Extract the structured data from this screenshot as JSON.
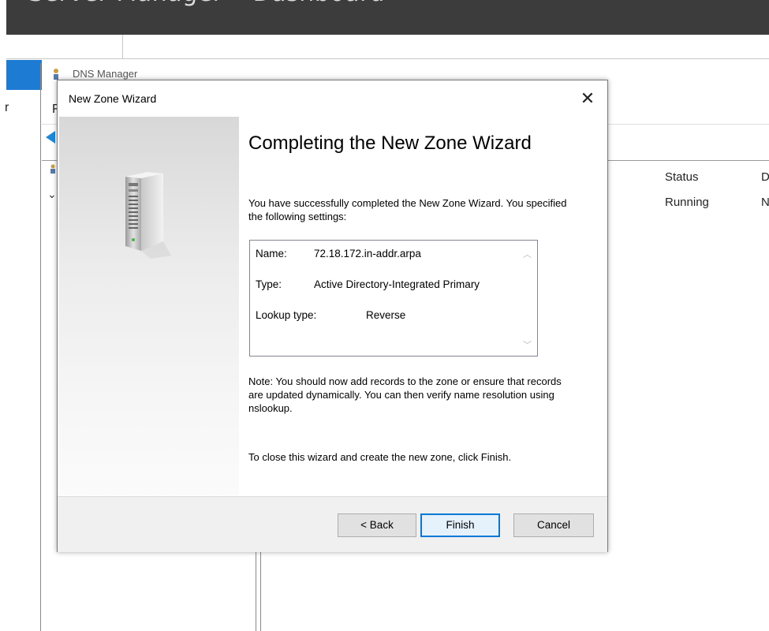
{
  "server_manager": {
    "title": "Server Manager • Dashboard",
    "left_edge_text": "r"
  },
  "dns_manager": {
    "title": "DNS Manager",
    "menu_letter": "F",
    "columns": {
      "status": "Status",
      "d": "D"
    },
    "row": {
      "status": "Running",
      "d": "N"
    }
  },
  "wizard": {
    "title": "New Zone Wizard",
    "close_glyph": "✕",
    "heading": "Completing the New Zone Wizard",
    "intro": "You have successfully completed the New Zone Wizard. You specified the following settings:",
    "settings": {
      "name_label": "Name:",
      "name_value": "72.18.172.in-addr.arpa",
      "type_label": "Type:",
      "type_value": "Active Directory-Integrated Primary",
      "lookup_label": "Lookup type:",
      "lookup_value": "Reverse"
    },
    "note": "Note: You should now add records to the zone or ensure that records are updated dynamically. You can then verify name resolution using nslookup.",
    "closing": "To close this wizard and create the new zone, click Finish.",
    "buttons": {
      "back": "< Back",
      "finish": "Finish",
      "cancel": "Cancel"
    }
  },
  "icons": [
    "close-icon",
    "server-icon",
    "back-arrow-icon",
    "scroll-up-icon",
    "scroll-down-icon",
    "dns-manager-icon"
  ]
}
